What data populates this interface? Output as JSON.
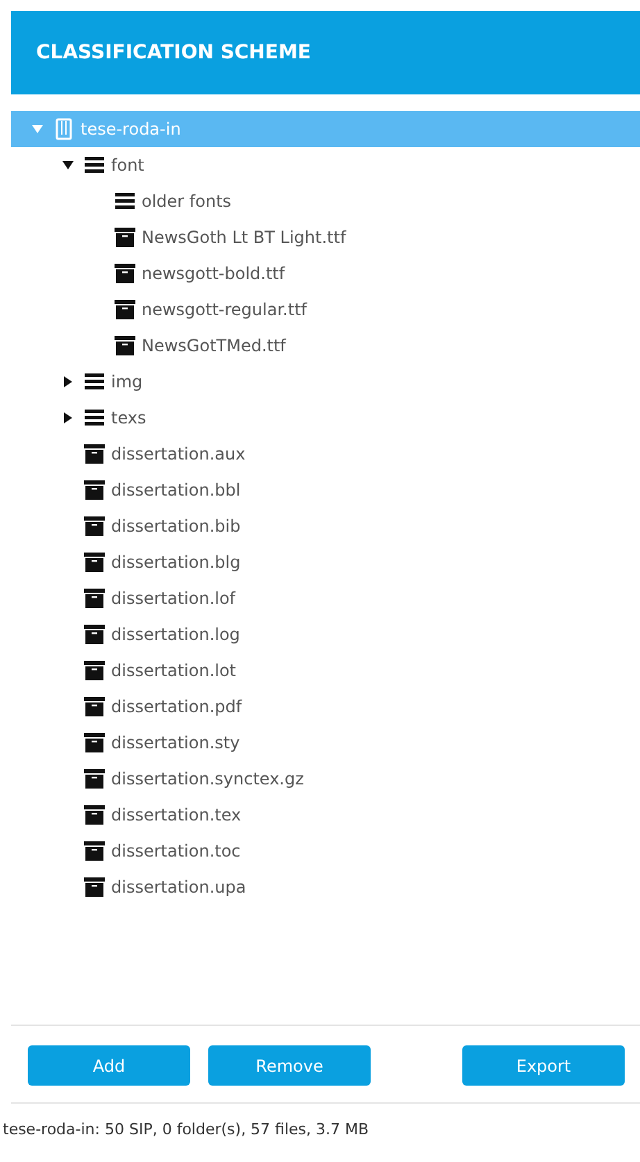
{
  "header": {
    "title": "CLASSIFICATION SCHEME"
  },
  "tree": [
    {
      "kind": "sip",
      "label": "tese-roda-in",
      "selected": true,
      "expanded": true,
      "children": [
        {
          "kind": "folder",
          "label": "font",
          "selected": false,
          "expanded": true,
          "children": [
            {
              "kind": "folder",
              "label": "older fonts",
              "selected": false
            },
            {
              "kind": "file",
              "label": "NewsGoth Lt BT Light.ttf",
              "selected": false
            },
            {
              "kind": "file",
              "label": "newsgott-bold.ttf",
              "selected": false
            },
            {
              "kind": "file",
              "label": "newsgott-regular.ttf",
              "selected": false
            },
            {
              "kind": "file",
              "label": "NewsGotTMed.ttf",
              "selected": false
            }
          ]
        },
        {
          "kind": "folder",
          "label": "img",
          "selected": false,
          "expanded": false
        },
        {
          "kind": "folder",
          "label": "texs",
          "selected": false,
          "expanded": false
        },
        {
          "kind": "file",
          "label": "dissertation.aux",
          "selected": false
        },
        {
          "kind": "file",
          "label": "dissertation.bbl",
          "selected": false
        },
        {
          "kind": "file",
          "label": "dissertation.bib",
          "selected": false
        },
        {
          "kind": "file",
          "label": "dissertation.blg",
          "selected": false
        },
        {
          "kind": "file",
          "label": "dissertation.lof",
          "selected": false
        },
        {
          "kind": "file",
          "label": "dissertation.log",
          "selected": false
        },
        {
          "kind": "file",
          "label": "dissertation.lot",
          "selected": false
        },
        {
          "kind": "file",
          "label": "dissertation.pdf",
          "selected": false
        },
        {
          "kind": "file",
          "label": "dissertation.sty",
          "selected": false
        },
        {
          "kind": "file",
          "label": "dissertation.synctex.gz",
          "selected": false
        },
        {
          "kind": "file",
          "label": "dissertation.tex",
          "selected": false
        },
        {
          "kind": "file",
          "label": "dissertation.toc",
          "selected": false
        },
        {
          "kind": "file",
          "label": "dissertation.upa",
          "selected": false
        }
      ]
    }
  ],
  "buttons": [
    {
      "label": "Add",
      "kind": "left"
    },
    {
      "label": "Remove",
      "kind": "left"
    },
    {
      "label": "Export",
      "kind": "right"
    }
  ],
  "status_bar": "tese-roda-in: 50 SIP, 0 folder(s), 57  files, 3.7 MB"
}
